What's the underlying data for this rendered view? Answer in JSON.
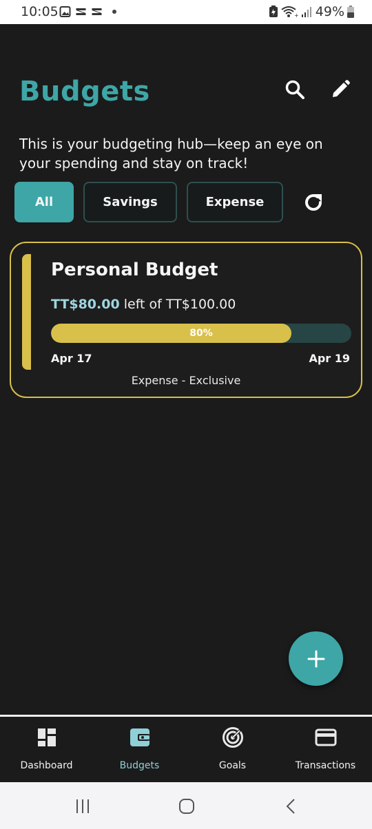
{
  "status_bar": {
    "time": "10:05",
    "battery_percent": "49%",
    "left_icons": [
      "image-icon",
      "capcut-icon",
      "capcut-icon"
    ],
    "right_icons": [
      "battery-saver-icon",
      "wifi-icon",
      "signal-icon",
      "battery-icon"
    ]
  },
  "header": {
    "title": "Budgets",
    "subtitle": "This is your budgeting hub—keep an eye on your spending and stay on track!"
  },
  "filters": {
    "items": [
      {
        "label": "All",
        "selected": true
      },
      {
        "label": "Savings",
        "selected": false
      },
      {
        "label": "Expense",
        "selected": false
      }
    ]
  },
  "budgets": [
    {
      "name": "Personal Budget",
      "amount_left": "TT$80.00",
      "amount_text": " left of TT$100.00",
      "progress_label": "80%",
      "progress": 0.8,
      "start_date": "Apr 17",
      "end_date": "Apr 19",
      "type_label": "Expense - Exclusive"
    }
  ],
  "bottom_nav": {
    "items": [
      {
        "label": "Dashboard",
        "icon": "dashboard-icon",
        "active": false
      },
      {
        "label": "Budgets",
        "icon": "wallet-icon",
        "active": true
      },
      {
        "label": "Goals",
        "icon": "target-icon",
        "active": false
      },
      {
        "label": "Transactions",
        "icon": "credit-card-icon",
        "active": false
      }
    ]
  },
  "colors": {
    "accent": "#3ea6a6",
    "background": "#1b1b1b",
    "card_border": "#d9c04a",
    "progress_fill": "#d9c04a",
    "progress_track": "#274545",
    "amount_highlight": "#9fd6e0",
    "active_nav": "#8fd0d8"
  }
}
